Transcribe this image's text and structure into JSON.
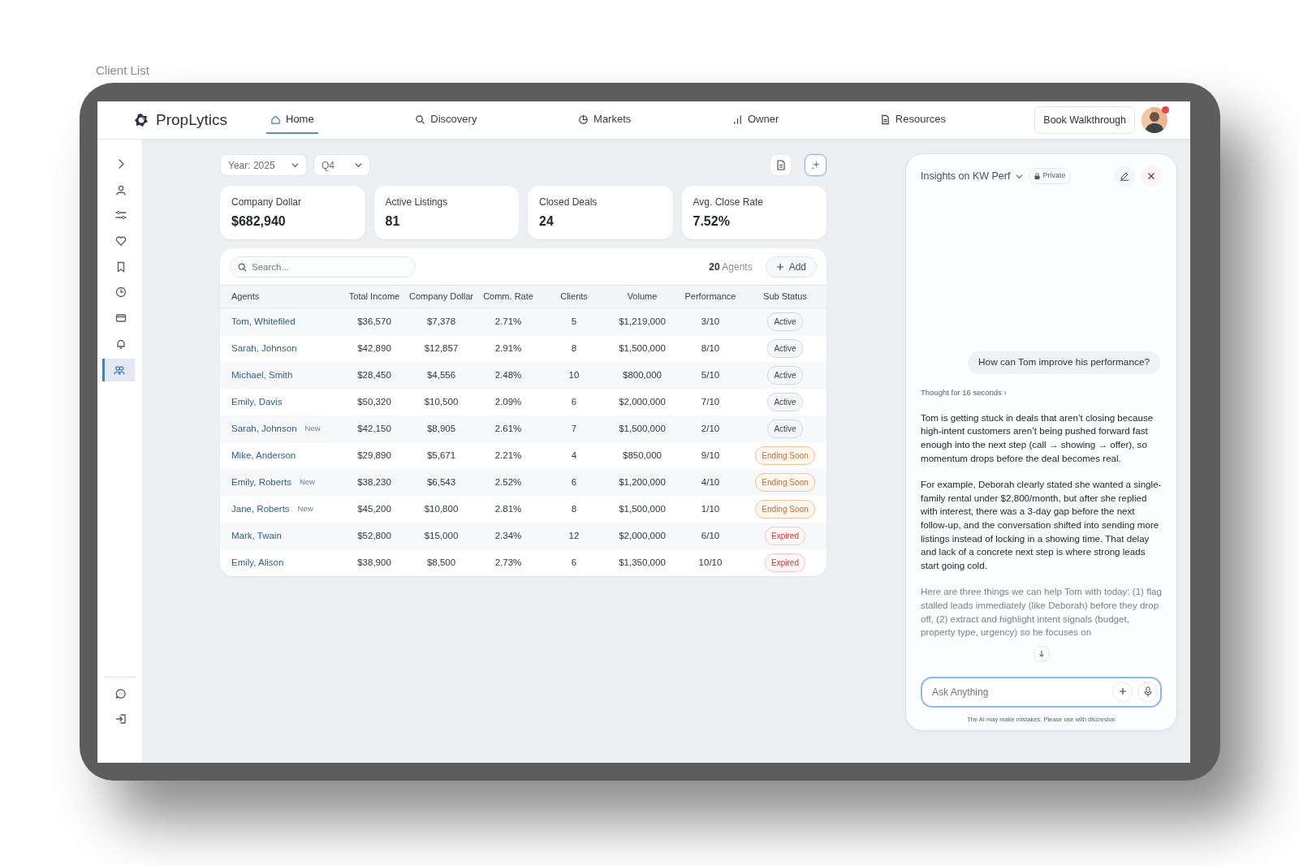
{
  "frame_title": "Client List",
  "brand": "PropLytics",
  "nav": [
    {
      "label": "Home",
      "selected": true
    },
    {
      "label": "Discovery",
      "selected": false
    },
    {
      "label": "Markets",
      "selected": false
    },
    {
      "label": "Owner",
      "selected": false
    },
    {
      "label": "Resources",
      "selected": false
    }
  ],
  "walkthrough_button": "Book Walkthrough",
  "sidebar": {
    "items": [
      {
        "selected": false
      },
      {
        "selected": false
      },
      {
        "selected": false
      },
      {
        "selected": false
      },
      {
        "selected": false
      },
      {
        "selected": false
      },
      {
        "selected": false
      },
      {
        "selected": false
      },
      {
        "selected": true
      }
    ],
    "bottom_items": [
      {
        "selected": false
      },
      {
        "selected": false
      }
    ]
  },
  "filters": [
    {
      "value": "Year: 2025"
    },
    {
      "value": "Q4"
    }
  ],
  "stats": [
    {
      "label": "Company Dollar",
      "value": "$682,940"
    },
    {
      "label": "Active Listings",
      "value": "81"
    },
    {
      "label": "Closed Deals",
      "value": "24"
    },
    {
      "label": "Avg. Close Rate",
      "value": "7.52%"
    }
  ],
  "table": {
    "search": {
      "placeholder": "Search..."
    },
    "agent_count": "20",
    "agent_count_label": "Agents",
    "add_button": "Add",
    "columns": [
      "Agents",
      "Total Income",
      "Company Dollar",
      "Comm. Rate",
      "Clients",
      "Volume",
      "Performance",
      "Sub Status"
    ],
    "rows": [
      {
        "agent": "Tom, Whitefiled",
        "income": "$36,570",
        "company_dollar": "$7,378",
        "rate": "2.71%",
        "clients": "5",
        "volume": "$1,219,000",
        "performance": "3/10",
        "status": "Active",
        "kind": "active"
      },
      {
        "agent": "Sarah, Johnson",
        "income": "$42,890",
        "company_dollar": "$12,857",
        "rate": "2.91%",
        "clients": "8",
        "volume": "$1,500,000",
        "performance": "8/10",
        "status": "Active",
        "kind": "active"
      },
      {
        "agent": "Michael, Smith",
        "income": "$28,450",
        "company_dollar": "$4,556",
        "rate": "2.48%",
        "clients": "10",
        "volume": "$800,000",
        "performance": "5/10",
        "status": "Active",
        "kind": "active"
      },
      {
        "agent": "Emily, Davis",
        "income": "$50,320",
        "company_dollar": "$10,500",
        "rate": "2.09%",
        "clients": "6",
        "volume": "$2,000,000",
        "performance": "7/10",
        "status": "Active",
        "kind": "active"
      },
      {
        "agent": "Sarah, Johnson",
        "tag": "New",
        "income": "$42,150",
        "company_dollar": "$8,905",
        "rate": "2.61%",
        "clients": "7",
        "volume": "$1,500,000",
        "performance": "2/10",
        "status": "Active",
        "kind": "active"
      },
      {
        "agent": "Mike, Anderson",
        "income": "$29,890",
        "company_dollar": "$5,671",
        "rate": "2.21%",
        "clients": "4",
        "volume": "$850,000",
        "performance": "9/10",
        "status": "Ending Soon",
        "kind": "ending"
      },
      {
        "agent": "Emily, Roberts",
        "tag": "New",
        "income": "$38,230",
        "company_dollar": "$6,543",
        "rate": "2.52%",
        "clients": "6",
        "volume": "$1,200,000",
        "performance": "4/10",
        "status": "Ending Soon",
        "kind": "ending"
      },
      {
        "agent": "Jane, Roberts",
        "tag": "New",
        "income": "$45,200",
        "company_dollar": "$10,800",
        "rate": "2.81%",
        "clients": "8",
        "volume": "$1,500,000",
        "performance": "1/10",
        "status": "Ending Soon",
        "kind": "ending"
      },
      {
        "agent": "Mark, Twain",
        "income": "$52,800",
        "company_dollar": "$15,000",
        "rate": "2.34%",
        "clients": "12",
        "volume": "$2,000,000",
        "performance": "6/10",
        "status": "Expired",
        "kind": "expired"
      },
      {
        "agent": "Emily, Alison",
        "income": "$38,900",
        "company_dollar": "$8,500",
        "rate": "2.73%",
        "clients": "6",
        "volume": "$1,350,000",
        "performance": "10/10",
        "status": "Expired",
        "kind": "expired"
      }
    ]
  },
  "chat": {
    "title": "Insights on KW Perf",
    "privacy": "Private",
    "user_message": "How can Tom improve his performance?",
    "thought": "Thought for 16 seconds ›",
    "paragraphs": [
      "Tom is getting stuck in deals that aren’t closing because high-intent customers aren’t being pushed forward fast enough into the next step (call → showing → offer), so momentum drops before the deal becomes real.",
      "For example, Deborah clearly stated she wanted a single-family rental under $2,800/month, but after she replied with interest, there was a 3-day gap before the next follow-up, and the conversation shifted into sending more listings instead of locking in a showing time. That delay and lack of a concrete next step is where strong leads start going cold.",
      "Here are three things we can help Tom with today: (1) flag stalled leads immediately (like Deborah) before they drop off, (2) extract and highlight intent signals (budget, property type, urgency) so he focuses on"
    ],
    "input": {
      "placeholder": "Ask Anything"
    },
    "disclaimer": "The AI may make mistakes. Please use with discresion"
  }
}
